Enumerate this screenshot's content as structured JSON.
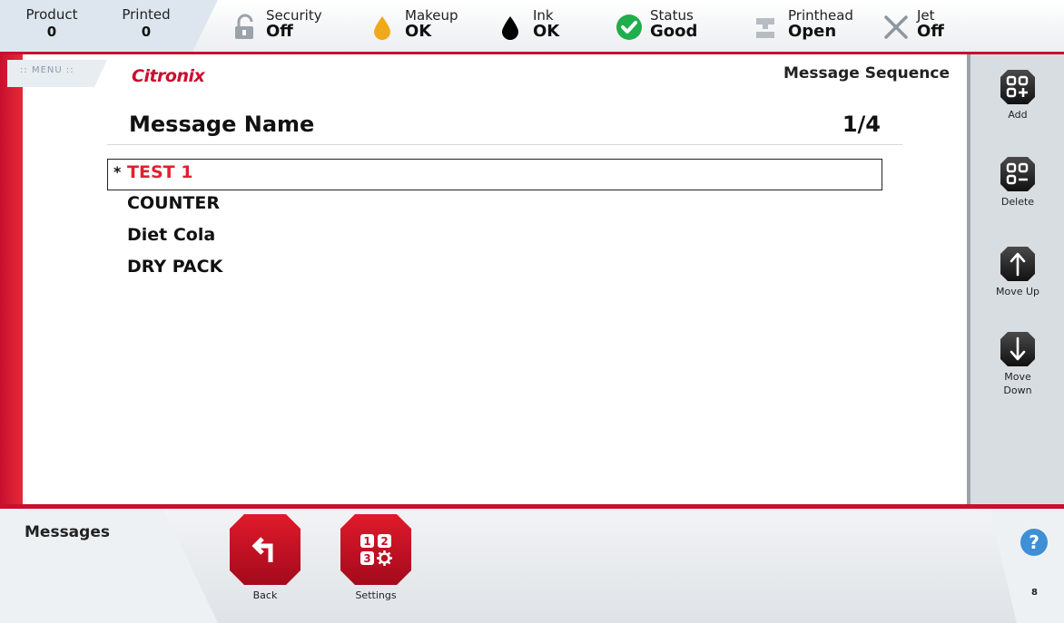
{
  "topbar": {
    "product": {
      "label": "Product",
      "value": "0"
    },
    "printed": {
      "label": "Printed",
      "value": "0"
    },
    "security": {
      "label": "Security",
      "value": "Off"
    },
    "makeup": {
      "label": "Makeup",
      "value": "OK"
    },
    "ink": {
      "label": "Ink",
      "value": "OK"
    },
    "status": {
      "label": "Status",
      "value": "Good"
    },
    "printhead": {
      "label": "Printhead",
      "value": "Open"
    },
    "jet": {
      "label": "Jet",
      "value": "Off"
    }
  },
  "header": {
    "menu_label": "MENU",
    "logo": "Citronix",
    "title": "Message Sequence"
  },
  "list": {
    "column_header": "Message Name",
    "page_indicator": "1/4",
    "selected_marker": "*",
    "items": [
      {
        "name": "TEST 1",
        "selected": true
      },
      {
        "name": "COUNTER",
        "selected": false
      },
      {
        "name": "Diet Cola",
        "selected": false
      },
      {
        "name": "DRY PACK",
        "selected": false
      }
    ]
  },
  "sidebar": {
    "add": "Add",
    "delete": "Delete",
    "move_up": "Move Up",
    "move_down": "Move Down"
  },
  "bottom": {
    "section_title": "Messages",
    "back": "Back",
    "settings": "Settings",
    "page_number": "8"
  },
  "colors": {
    "brand_red": "#c8102e",
    "selected_text": "#e0202e",
    "status_ok": "#1fae4b",
    "makeup_drop": "#f0a91c",
    "help_blue": "#3d8fd6"
  }
}
